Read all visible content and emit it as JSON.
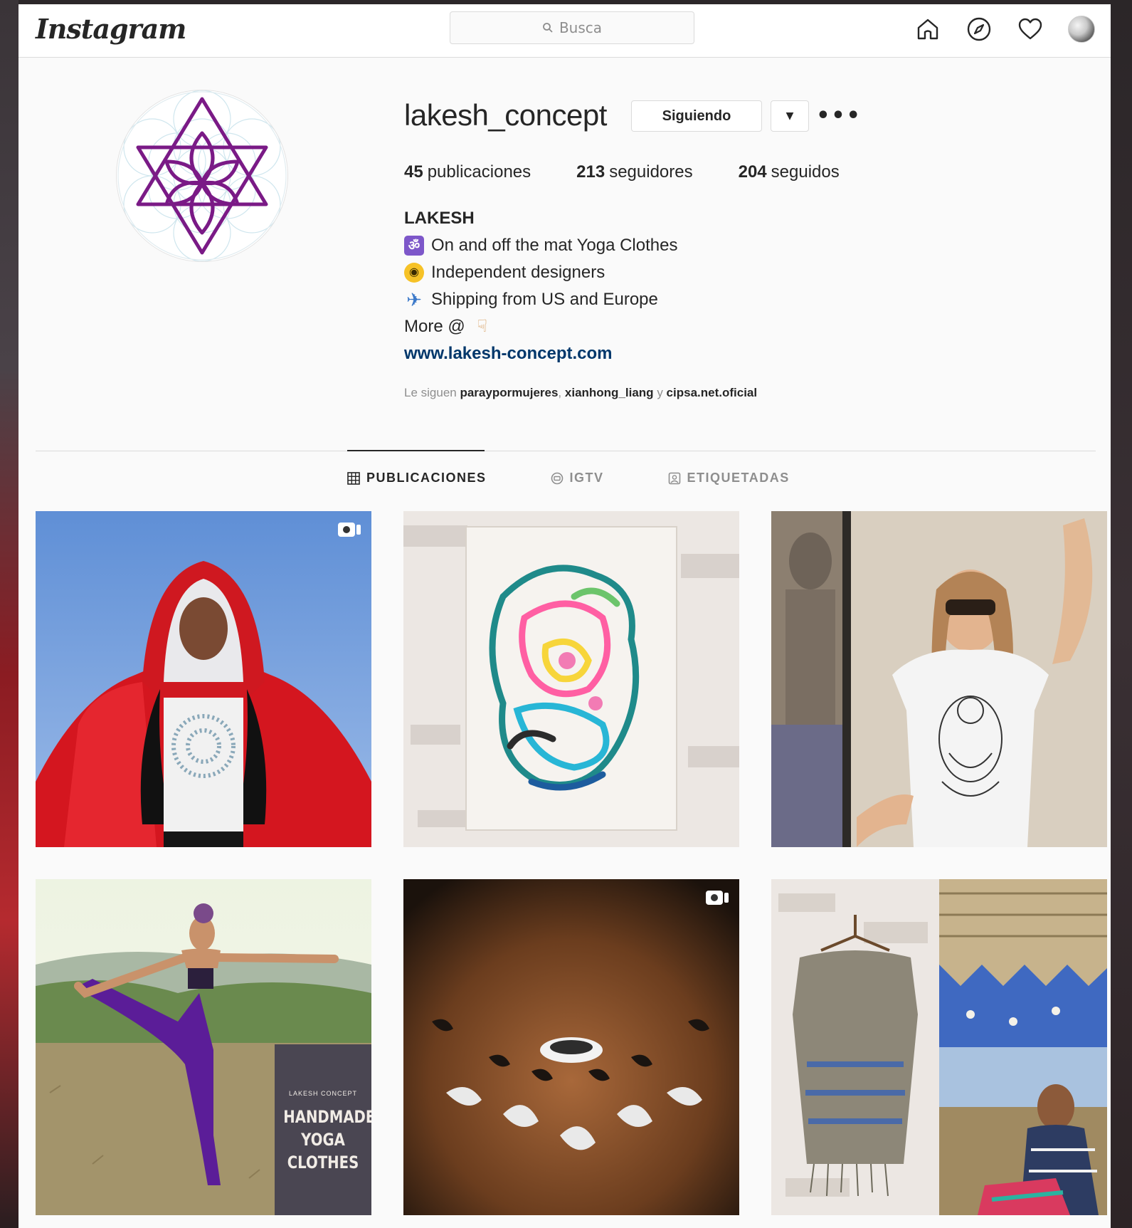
{
  "nav": {
    "logo": "Instagram",
    "search_placeholder": "Busca",
    "icons": [
      "home-icon",
      "explore-icon",
      "heart-icon",
      "profile-avatar"
    ]
  },
  "profile": {
    "username": "lakesh_concept",
    "follow_button": "Siguiendo",
    "stats": {
      "posts_count": "45",
      "posts_label": "publicaciones",
      "followers_count": "213",
      "followers_label": "seguidores",
      "following_count": "204",
      "following_label": "seguidos"
    },
    "bio": {
      "name": "LAKESH",
      "line1": "On and off the mat Yoga Clothes",
      "line2": "Independent designers",
      "line3": "Shipping from US and Europe",
      "line4": "More @",
      "website": "www.lakesh-concept.com"
    },
    "followed_by": {
      "prefix": "Le siguen",
      "user1": "paraypormujeres",
      "sep1": ",",
      "user2": "xianhong_liang",
      "sep2": "y",
      "user3": "cipsa.net.oficial"
    }
  },
  "tabs": [
    {
      "label": "PUBLICACIONES",
      "active": true
    },
    {
      "label": "IGTV",
      "active": false
    },
    {
      "label": "ETIQUETADAS",
      "active": false
    }
  ],
  "posts": [
    {
      "subject": "woman in red jacket with white tee",
      "video": true
    },
    {
      "subject": "abstract colorful painting on white wall",
      "video": false
    },
    {
      "subject": "woman in white ganesha t-shirt",
      "video": false
    },
    {
      "subject": "yoga pose purple pants",
      "video": false,
      "poster": {
        "brand": "LAKESH CONCEPT",
        "line1": "HANDMADE",
        "line2": "YOGA",
        "line3": "CLOTHES"
      }
    },
    {
      "subject": "clay lamp close-up",
      "video": true
    },
    {
      "subject": "embroidered blouse collage",
      "video": false
    }
  ],
  "colors": {
    "text": "#262626",
    "muted": "#8e8e8e",
    "link": "#00376b",
    "logo_purple": "#7a1a86",
    "border": "#dbdbdb"
  }
}
